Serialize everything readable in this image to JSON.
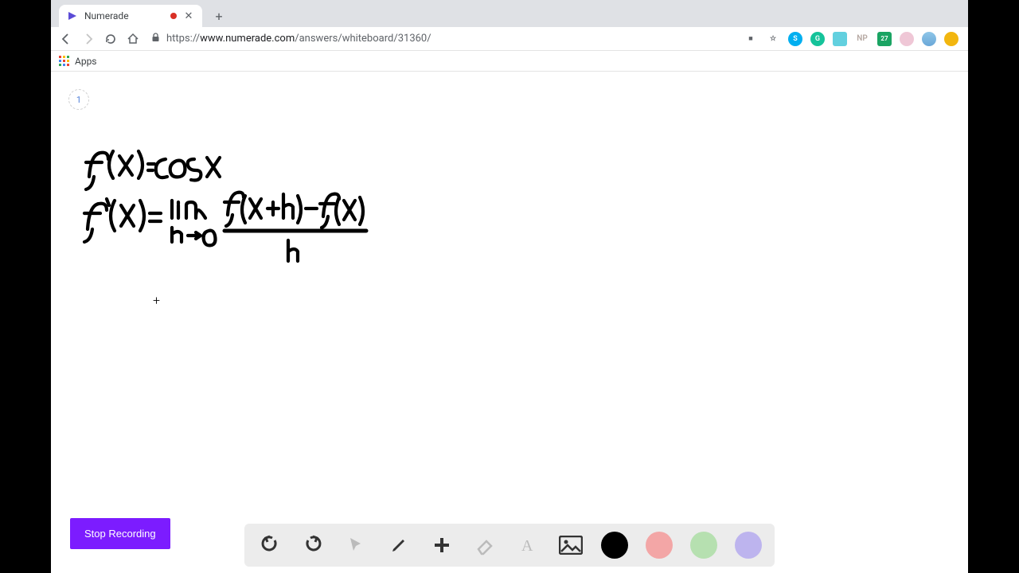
{
  "browser": {
    "tab": {
      "title": "Numerade"
    },
    "url": {
      "scheme": "https://",
      "host": "www.numerade.com",
      "path": "/answers/whiteboard/31360/"
    },
    "bookmarks": {
      "apps_label": "Apps"
    },
    "extensions": [
      {
        "name": "camera",
        "bg": "transparent",
        "glyph": "■",
        "color": "#5f6368"
      },
      {
        "name": "star",
        "bg": "transparent",
        "glyph": "☆",
        "color": "#5f6368"
      },
      {
        "name": "skype",
        "bg": "#00aff0",
        "glyph": "S"
      },
      {
        "name": "grammarly",
        "bg": "#15c39a",
        "glyph": "G"
      },
      {
        "name": "monitor",
        "bg": "#62d0df",
        "glyph": ""
      },
      {
        "name": "np",
        "bg": "#d9c6c0",
        "glyph": "NP",
        "color": "#8a7a74"
      },
      {
        "name": "cal",
        "bg": "#1aa463",
        "glyph": "27"
      },
      {
        "name": "pin",
        "bg": "#efc7d6",
        "glyph": ""
      },
      {
        "name": "globe",
        "bg": "#6aa7d8",
        "glyph": ""
      },
      {
        "name": "profile",
        "bg": "#f2b60f",
        "glyph": ""
      }
    ]
  },
  "page": {
    "page_number": "1",
    "cursor_plus": "+"
  },
  "whiteboard": {
    "line1": "f(x) = cos x",
    "line2": "f'(x) = lim_{h→0} (f(x+h) - f(x)) / h"
  },
  "controls": {
    "stop_recording": "Stop Recording"
  },
  "toolbar": {
    "tools": [
      "undo",
      "redo",
      "pointer",
      "pen",
      "add",
      "eraser",
      "text",
      "image"
    ],
    "colors": {
      "black": "#000000",
      "red": "#f3a6a6",
      "green": "#b6e0b0",
      "purple": "#bdb4ee"
    }
  }
}
